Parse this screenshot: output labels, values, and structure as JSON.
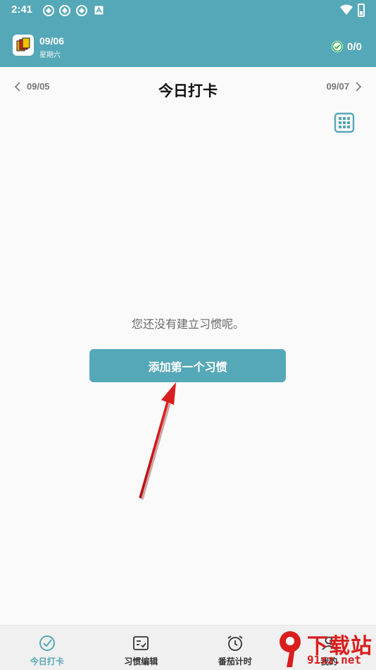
{
  "status_bar": {
    "time": "2:41"
  },
  "header": {
    "date": "09/06",
    "weekday": "星期六",
    "progress": "0/0"
  },
  "date_nav": {
    "prev": "09/05",
    "title": "今日打卡",
    "next": "09/07"
  },
  "empty_state": {
    "message": "您还没有建立习惯呢。",
    "add_button": "添加第一个习惯"
  },
  "bottom_nav": {
    "items": [
      {
        "label": "今日打卡",
        "icon": "check-circle-icon"
      },
      {
        "label": "习惯编辑",
        "icon": "checklist-icon"
      },
      {
        "label": "番茄计时",
        "icon": "alarm-clock-icon"
      },
      {
        "label": "我的",
        "icon": "profile-icon"
      }
    ]
  },
  "watermark": {
    "text_top": "下载站",
    "text_bottom": "91xz.net",
    "logo_text": "9"
  },
  "colors": {
    "primary": "#55a8b7",
    "arrow": "#d91e1e"
  }
}
